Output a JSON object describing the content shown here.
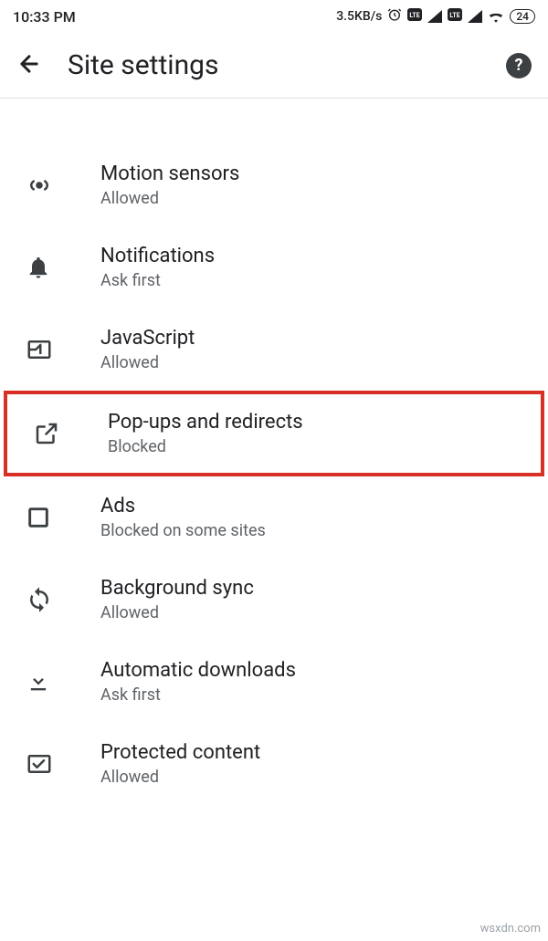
{
  "status_bar": {
    "time": "10:33 PM",
    "speed": "3.5KB/s",
    "battery": "24"
  },
  "header": {
    "title": "Site settings"
  },
  "cutoff_status": "Ask first",
  "items": [
    {
      "label": "Motion sensors",
      "status": "Allowed",
      "icon": "motion-sensors-icon",
      "highlight": false
    },
    {
      "label": "Notifications",
      "status": "Ask first",
      "icon": "notifications-icon",
      "highlight": false
    },
    {
      "label": "JavaScript",
      "status": "Allowed",
      "icon": "javascript-icon",
      "highlight": false
    },
    {
      "label": "Pop-ups and redirects",
      "status": "Blocked",
      "icon": "popups-icon",
      "highlight": true
    },
    {
      "label": "Ads",
      "status": "Blocked on some sites",
      "icon": "ads-icon",
      "highlight": false
    },
    {
      "label": "Background sync",
      "status": "Allowed",
      "icon": "sync-icon",
      "highlight": false
    },
    {
      "label": "Automatic downloads",
      "status": "Ask first",
      "icon": "downloads-icon",
      "highlight": false
    },
    {
      "label": "Protected content",
      "status": "Allowed",
      "icon": "protected-content-icon",
      "highlight": false
    }
  ],
  "watermark": "wsxdn.com"
}
